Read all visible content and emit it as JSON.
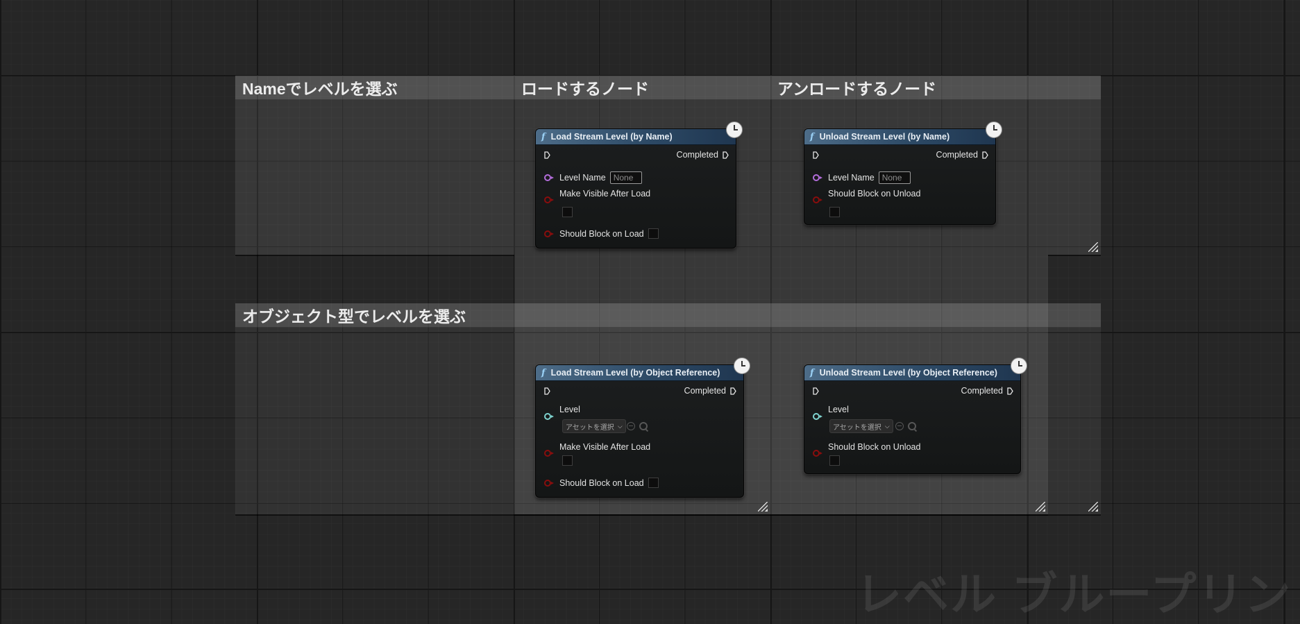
{
  "comments": {
    "by_name": "Nameでレベルを選ぶ",
    "load_nodes": "ロードするノード",
    "unload_nodes": "アンロードするノード",
    "by_object": "オブジェクト型でレベルを選ぶ"
  },
  "nodes": {
    "load_by_name": {
      "title": "Load Stream Level (by Name)",
      "completed": "Completed",
      "level_name": "Level Name",
      "level_name_value": "None",
      "make_visible": "Make Visible After Load",
      "should_block": "Should Block on Load"
    },
    "unload_by_name": {
      "title": "Unload Stream Level (by Name)",
      "completed": "Completed",
      "level_name": "Level Name",
      "level_name_value": "None",
      "should_block": "Should Block on Unload"
    },
    "load_by_object": {
      "title": "Load Stream Level (by Object Reference)",
      "completed": "Completed",
      "level": "Level",
      "asset_select": "アセットを選択",
      "make_visible": "Make Visible After Load",
      "should_block": "Should Block on Load"
    },
    "unload_by_object": {
      "title": "Unload Stream Level (by Object Reference)",
      "completed": "Completed",
      "level": "Level",
      "asset_select": "アセットを選択",
      "should_block": "Should Block on Unload"
    }
  },
  "watermark": "レベル ブループリント",
  "icons": [
    "function-icon",
    "clock-icon",
    "exec-pin-icon",
    "resize-grip-icon",
    "chevron-down-icon",
    "use-asset-icon",
    "search-icon"
  ],
  "colors": {
    "grid_bg": "#262626",
    "node_title": "#2d4a66",
    "pin_name": "#b36ddb",
    "pin_bool": "#8a0d0d",
    "pin_object": "#7fd4d0"
  }
}
